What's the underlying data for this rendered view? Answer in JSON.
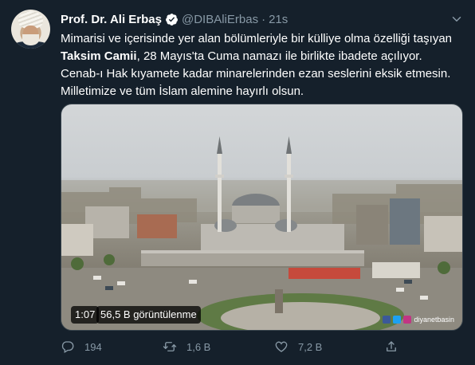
{
  "tweet": {
    "author_name": "Prof. Dr. Ali Erbaş",
    "handle": "@DIBAliErbas",
    "separator": "·",
    "time": "21s",
    "text_line1": "Mimarisi ve içerisinde yer alan bölümleriyle bir külliye olma özelliği taşıyan",
    "text_bold": "Taksim Camii",
    "text_line2_rest": ", 28 Mayıs'ta Cuma namazı ile birlikte ibadete açılıyor.",
    "text_line3": "Cenab-ı Hak kıyamete kadar minarelerinden ezan seslerini eksik etmesin.",
    "text_line4": "Milletimize ve tüm İslam alemine hayırlı olsun."
  },
  "media": {
    "duration": "1:07",
    "views": "56,5 B görüntülenme",
    "watermark": "diyanetbasin"
  },
  "actions": {
    "replies": "194",
    "retweets": "1,6 B",
    "likes": "7,2 B"
  },
  "colors": {
    "background": "#15202b",
    "secondary_text": "#8899a6",
    "verified": "#ffffff"
  }
}
